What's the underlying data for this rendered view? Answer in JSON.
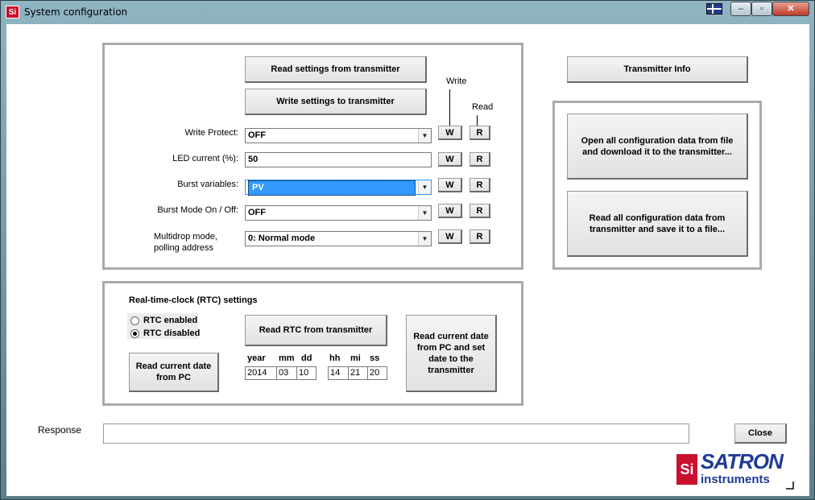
{
  "window": {
    "title": "System configuration",
    "app_icon_text": "Si",
    "controls": {
      "minimize": "–",
      "restore": "▫",
      "close": "✕"
    }
  },
  "top": {
    "read_settings": "Read settings from transmitter",
    "write_settings": "Write settings to transmitter",
    "write_header": "Write",
    "read_header": "Read",
    "w": "W",
    "r": "R",
    "rows": [
      {
        "label": "Write Protect:",
        "value": "OFF",
        "type": "combo"
      },
      {
        "label": "LED current (%):",
        "value": "50",
        "type": "text"
      },
      {
        "label": "Burst variables:",
        "value": "PV",
        "type": "combo"
      },
      {
        "label": "Burst Mode On / Off:",
        "value": "OFF",
        "type": "combo"
      },
      {
        "label": "Multidrop mode,",
        "label2": "polling address",
        "value": "0: Normal mode",
        "type": "combo"
      }
    ]
  },
  "right": {
    "transmitter_info": "Transmitter Info",
    "open_config_1": "Open all configuration data from file",
    "open_config_2": "and download it to the transmitter...",
    "read_config_1": "Read all configuration data from",
    "read_config_2": "transmitter and save it to a file..."
  },
  "rtc": {
    "title": "Real-time-clock (RTC) settings",
    "enabled": "RTC enabled",
    "disabled": "RTC disabled",
    "selected": "disabled",
    "read_pc_1": "Read current date",
    "read_pc_2": "from PC",
    "read_rtc": "Read RTC from transmitter",
    "set_1": "Read current date",
    "set_2": "from PC and set",
    "set_3": "date to the",
    "set_4": "transmitter",
    "headers": {
      "year": "year",
      "mm": "mm",
      "dd": "dd",
      "hh": "hh",
      "mi": "mi",
      "ss": "ss"
    },
    "values": {
      "year": "2014",
      "mm": "03",
      "dd": "10",
      "hh": "14",
      "mi": "21",
      "ss": "20"
    }
  },
  "response_label": "Response",
  "response_value": "",
  "close_button": "Close",
  "logo": {
    "line1": "SATRON",
    "line2": "instruments",
    "mark": "Si"
  },
  "colors": {
    "selection": "#3399ff",
    "logo_red": "#c8102e",
    "logo_blue": "#1f3a93"
  }
}
